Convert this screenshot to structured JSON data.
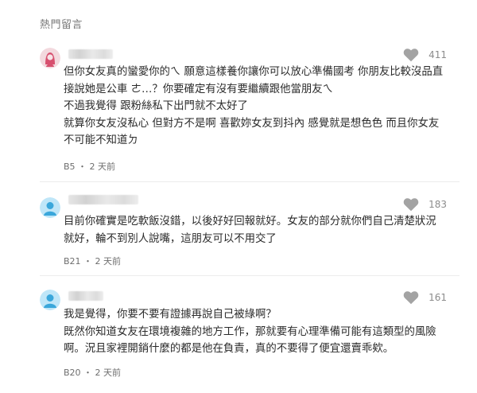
{
  "section_title": "熱門留言",
  "colors": {
    "heart": "#a3a3a3",
    "avatar1_bg": "#f3d9de",
    "avatar1_fg": "#d7506f",
    "avatar2_bg": "#bfe6f8",
    "avatar2_fg": "#3aa7db"
  },
  "comments": [
    {
      "avatar_icon": "female-avatar-icon",
      "likes": "411",
      "lines": [
        "但你女友真的蠻愛你的ㄟ 願意這樣養你讓你可以放心準備國考 你朋友比較沒品直",
        "接說她是公車 ㄜ…？你要確定有沒有要繼續跟他當朋友ㄟ",
        "不過我覺得 跟粉絲私下出門就不太好了",
        "就算你女友沒私心 但對方不是啊 喜歡妳女友到抖內 感覺就是想色色 而且你女友",
        "不可能不知道ㄉ"
      ],
      "floor": "B5",
      "time": "2 天前"
    },
    {
      "avatar_icon": "male-avatar-icon",
      "likes": "183",
      "lines": [
        "目前你確實是吃軟飯沒錯，以後好好回報就好。女友的部分就你們自己清楚狀況",
        "就好，輪不到別人說嘴，這朋友可以不用交了"
      ],
      "floor": "B21",
      "time": "2 天前"
    },
    {
      "avatar_icon": "male-avatar-icon",
      "likes": "161",
      "lines": [
        "我是覺得，你要不要有證據再說自己被綠啊？",
        "既然你知道女友在環境複雜的地方工作，那就要有心理準備可能有這類型的風險",
        "啊。況且家裡開銷什麼的都是他在負責，真的不要得了便宜還賣乖欸。"
      ],
      "floor": "B20",
      "time": "2 天前"
    }
  ]
}
